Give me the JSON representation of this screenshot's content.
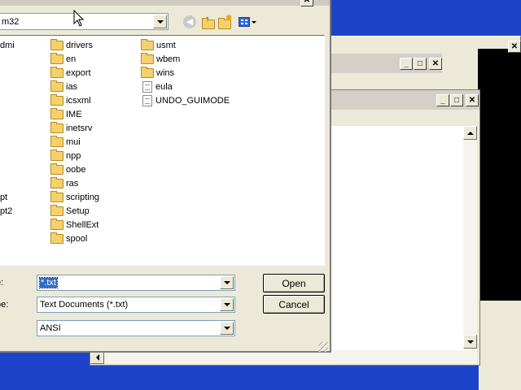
{
  "dialog": {
    "lookin_value": "m32",
    "left_col_items": [
      "dmi",
      "pt",
      "pt2"
    ],
    "folders_col1": [
      "drivers",
      "en",
      "export",
      "ias",
      "icsxml",
      "IME",
      "inetsrv",
      "mui",
      "npp",
      "oobe",
      "ras",
      "scripting",
      "Setup",
      "ShellExt",
      "spool"
    ],
    "col2_folders": [
      "usmt",
      "wbem",
      "wins"
    ],
    "col2_files": [
      "eula",
      "UNDO_GUIMODE"
    ],
    "filename_label": "e:",
    "filename_value": "*.txt",
    "filetype_label": "pe:",
    "filetype_value": "Text Documents (*.txt)",
    "encoding_value": "ANSI",
    "open_label": "Open",
    "cancel_label": "Cancel"
  },
  "colors": {
    "desktop": "#1d44c8",
    "window_face": "#ece9d8",
    "selection": "#316ac5"
  },
  "icons": [
    "back-icon",
    "up-folder-icon",
    "new-folder-icon",
    "views-menu-icon",
    "folder-icon",
    "file-icon",
    "mouse-cursor-icon"
  ]
}
